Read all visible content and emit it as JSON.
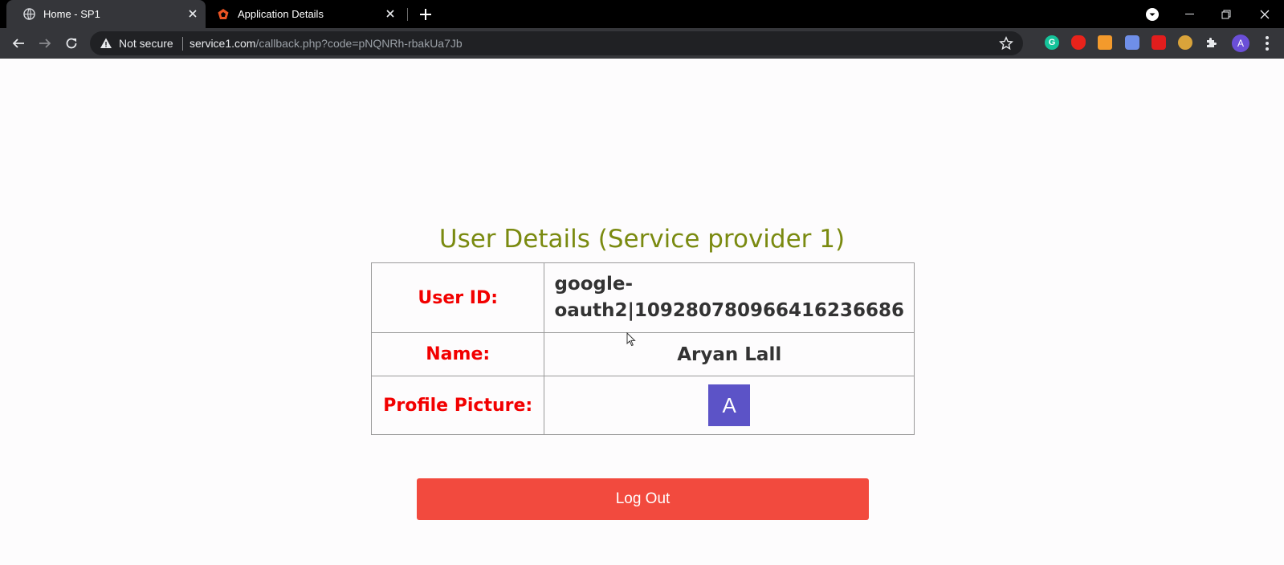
{
  "browser": {
    "tabs": [
      {
        "title": "Home - SP1",
        "active": true,
        "icon": "globe-icon"
      },
      {
        "title": "Application Details",
        "active": false,
        "icon": "auth0-icon"
      }
    ],
    "address_bar": {
      "security_label": "Not secure",
      "url_host": "service1.com",
      "url_rest": "/callback.php?code=pNQNRh-rbakUa7Jb"
    },
    "profile_initial": "A",
    "extensions": [
      "grammarly-icon",
      "extension-red-icon",
      "extension-orange-icon",
      "extension-blue-icon",
      "extension-red2-icon",
      "extension-yellow-icon",
      "puzzle-icon"
    ]
  },
  "page": {
    "heading": "User Details (Service provider 1)",
    "rows": [
      {
        "label": "User ID:",
        "value": "google-oauth2|109280780966416236686"
      },
      {
        "label": "Name:",
        "value": "Aryan Lall"
      },
      {
        "label": "Profile Picture:",
        "avatar_initial": "A"
      }
    ],
    "logout_label": "Log Out"
  },
  "colors": {
    "heading": "#7a8a10",
    "label": "#f20000",
    "logout_button": "#f24a3e",
    "avatar": "#5c53c7"
  }
}
